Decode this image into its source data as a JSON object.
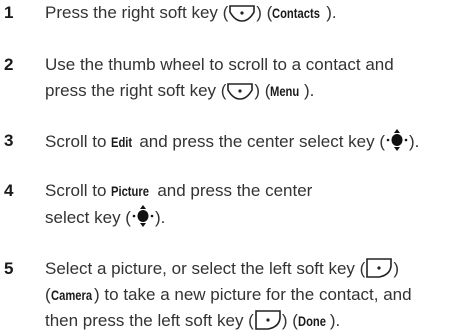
{
  "steps": [
    {
      "number": "1",
      "text_a": "Press the right soft key (",
      "text_b": ") (",
      "label_a": "Contacts",
      "text_c": ")."
    },
    {
      "number": "2",
      "line1": "Use the thumb wheel to scroll to a contact and",
      "text_a": "press the right soft key (",
      "text_b": ") (",
      "label_a": "Menu",
      "text_c": ")."
    },
    {
      "number": "3",
      "text_a": "Scroll to ",
      "label_a": "Edit",
      "text_b": " and press the center select key (",
      "text_c": ")."
    },
    {
      "number": "4",
      "text_a": "Scroll to ",
      "label_a": "Picture",
      "text_b": " and press the center",
      "line2_a": "select key (",
      "line2_b": ")."
    },
    {
      "number": "5",
      "line1_a": "Select a picture, or select the left soft key (",
      "line1_b": ")",
      "line2_a": "(",
      "label_a": "Camera",
      "line2_b": ") to take a new picture for the contact, and",
      "line3_a": "then press the left soft key (",
      "line3_b": ") (",
      "label_b": "Done",
      "line3_c": ")."
    }
  ],
  "icons": {
    "right_soft_key": "right-soft-key-icon",
    "left_soft_key": "left-soft-key-icon",
    "center_select_key": "center-select-key-icon"
  }
}
